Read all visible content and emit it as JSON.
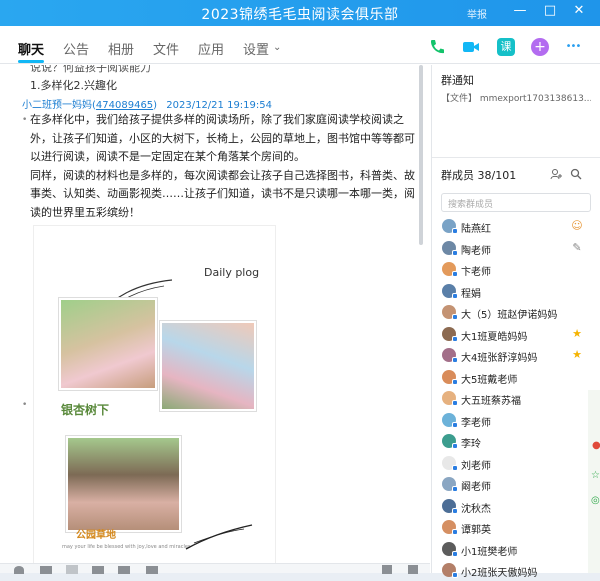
{
  "window": {
    "title": "2023锦绣毛毛虫阅读会俱乐部",
    "report_label": "举报",
    "minimize_glyph": "—",
    "maximize_glyph": "□",
    "close_glyph": "✕"
  },
  "tabs": [
    {
      "label": "聊天"
    },
    {
      "label": "公告"
    },
    {
      "label": "相册"
    },
    {
      "label": "文件"
    },
    {
      "label": "应用"
    },
    {
      "label": "设置"
    }
  ],
  "top_icons": {
    "phone": "phone-icon",
    "video": "video-icon",
    "course": "课",
    "add": "+",
    "more": "•••"
  },
  "chat": {
    "partial_line": "说说？何益孩子阅读能力",
    "numbered_line": "1.多样化2.兴趣化",
    "sender": "小二班预一妈妈(",
    "sender_qq": "474089465",
    "sender_suffix": ")",
    "timestamp": "2023/12/21 19:19:54",
    "paragraphs": [
      "在多样化中，我们给孩子提供多样的阅读场所，除了我们家庭阅读学校阅读之外，让孩子们知道，小区的大树下，长椅上，公园的草地上，图书馆中等等都可以进行阅读，阅读不是一定固定在某个角落某个房间的。",
      "同样，阅读的材料也是多样的，每次阅读都会让孩子自己选择图书，科普类、故事类、认知类、动画影视类……让孩子们知道，读书不是只读哪一本哪一类，阅读的世界里五彩缤纷！"
    ],
    "poster": {
      "heading": "Daily plog",
      "caption_1": "银杏树下",
      "caption_2": "公园草地",
      "footnote": "may your life be blessed with joy,love and miracles"
    }
  },
  "side": {
    "notice_title": "群通知",
    "notice_text": "【文件】 mmexport1703138613...",
    "members_title": "群成员 38/101",
    "search_placeholder": "搜索群成员",
    "members": [
      {
        "name": "陆燕红",
        "color": "#7aa3c6",
        "right": "person"
      },
      {
        "name": "陶老师",
        "color": "#6d88a5",
        "right": "edit"
      },
      {
        "name": "卞老师",
        "color": "#e39a5b",
        "right": ""
      },
      {
        "name": "程娟",
        "color": "#5a7fa8",
        "right": ""
      },
      {
        "name": "大（5）班赵伊诺妈妈",
        "color": "#c49373",
        "right": ""
      },
      {
        "name": "大1班夏皓妈妈",
        "color": "#8c6a51",
        "right": "star"
      },
      {
        "name": "大4班张舒淳妈妈",
        "color": "#a36f89",
        "right": "star"
      },
      {
        "name": "大5班戴老师",
        "color": "#d98c5a",
        "right": ""
      },
      {
        "name": "大五班蔡苏福",
        "color": "#e6b17f",
        "right": ""
      },
      {
        "name": "李老师",
        "color": "#6cb2d9",
        "right": ""
      },
      {
        "name": "李玲",
        "color": "#3c9d8e",
        "right": ""
      },
      {
        "name": "刘老师",
        "color": "#e8e8e8",
        "right": ""
      },
      {
        "name": "阚老师",
        "color": "#8aa6c2",
        "right": ""
      },
      {
        "name": "沈秋杰",
        "color": "#4d6e96",
        "right": ""
      },
      {
        "name": "谭郭英",
        "color": "#d58f62",
        "right": ""
      },
      {
        "name": "小1班樊老师",
        "color": "#5c5c5c",
        "right": ""
      },
      {
        "name": "小2班张天傲妈妈",
        "color": "#b37f68",
        "right": ""
      }
    ]
  }
}
